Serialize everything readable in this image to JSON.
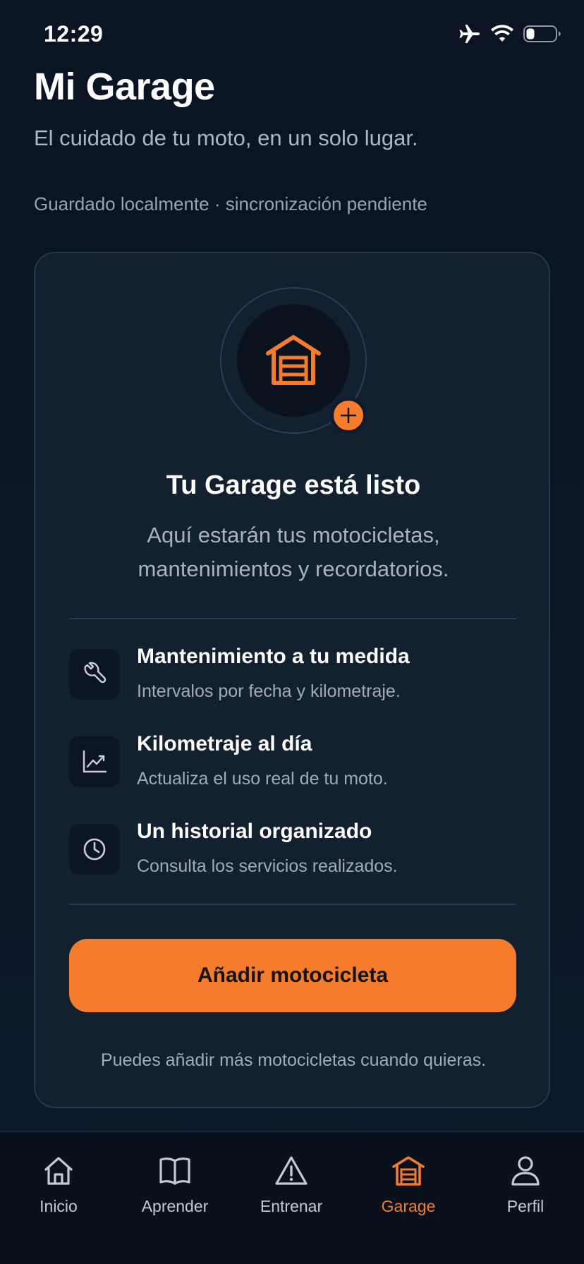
{
  "status_bar": {
    "time": "12:29"
  },
  "header": {
    "title": "Mi Garage",
    "subtitle": "El cuidado de tu moto, en un solo lugar.",
    "sync_status": "Guardado localmente · sincronización pendiente"
  },
  "card": {
    "title": "Tu Garage está listo",
    "description_line1": "Aquí estarán tus motocicletas,",
    "description_line2": "mantenimientos y recordatorios.",
    "features": [
      {
        "icon": "wrench-icon",
        "title": "Mantenimiento a tu medida",
        "desc": "Intervalos por fecha y kilometraje."
      },
      {
        "icon": "trend-chart-icon",
        "title": "Kilometraje al día",
        "desc": "Actualiza el uso real de tu moto."
      },
      {
        "icon": "clock-icon",
        "title": "Un historial organizado",
        "desc": "Consulta los servicios realizados."
      }
    ],
    "primary_button": "Añadir motocicleta",
    "footer_note": "Puedes añadir más motocicletas cuando quieras."
  },
  "tabs": [
    {
      "label": "Inicio",
      "icon": "home-icon",
      "active": false
    },
    {
      "label": "Aprender",
      "icon": "book-icon",
      "active": false
    },
    {
      "label": "Entrenar",
      "icon": "warning-icon",
      "active": false
    },
    {
      "label": "Garage",
      "icon": "garage-icon",
      "active": true
    },
    {
      "label": "Perfil",
      "icon": "user-icon",
      "active": false
    }
  ],
  "colors": {
    "accent": "#f47c2c",
    "background": "#0b1626",
    "card": "#13202f"
  }
}
